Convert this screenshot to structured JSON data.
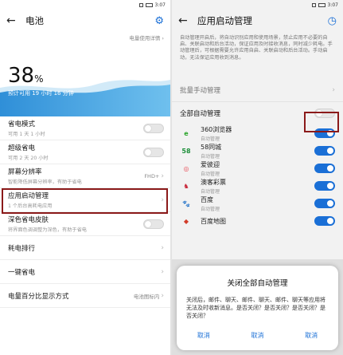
{
  "status": {
    "time": "3:07"
  },
  "left": {
    "title": "电池",
    "usage_link": "电量使用详情",
    "percent": "38",
    "percent_unit": "%",
    "estimate": "预计可用 19 小时 16 分钟",
    "items": [
      {
        "label": "省电模式",
        "sub": "可用 1 天 1 小时",
        "control": "switch-off"
      },
      {
        "label": "超级省电",
        "sub": "可用 2 天 20 小时",
        "control": "switch-off"
      },
      {
        "label": "屏幕分辨率",
        "sub": "智能降低屏幕分辨率，有助于省电",
        "value": "FHD+",
        "control": "chevron"
      },
      {
        "label": "应用启动管理",
        "sub": "1 个后台高耗电应用",
        "control": "chevron"
      },
      {
        "label": "深色省电皮肤",
        "sub": "将界面色调调整为深色，有助于省电",
        "control": "switch-off"
      },
      {
        "label": "耗电排行",
        "sub": "",
        "control": "chevron"
      },
      {
        "label": "一键省电",
        "sub": "",
        "control": "chevron"
      },
      {
        "label": "电量百分比显示方式",
        "sub": "",
        "value": "电池图标内",
        "control": "chevron"
      }
    ]
  },
  "right": {
    "title": "应用启动管理",
    "description": "自动管理开启后，将自动识别应用和使用场景，禁止应用不必要的自启、关联启动和后台活动，保证应用及时接收消息，同时减少耗电。手动管理后，可根据需要允许应用自启、关联启动和后台活动。手动启动，无法保证应用收到消息。",
    "batch_label": "批量手动管理",
    "all_label": "全部自动管理",
    "apps": [
      {
        "name": "360浏览器",
        "sub": "自动管理",
        "icon": "e",
        "color": "#2aa52a"
      },
      {
        "name": "58同城",
        "sub": "自动管理",
        "icon": "58",
        "color": "#1d8f3a"
      },
      {
        "name": "爱彼迎",
        "sub": "自动管理",
        "icon": "◎",
        "color": "#e8505b"
      },
      {
        "name": "澳客彩票",
        "sub": "自动管理",
        "icon": "♞",
        "color": "#c8283a"
      },
      {
        "name": "百度",
        "sub": "自动管理",
        "icon": "🐾",
        "color": "#2932e1"
      },
      {
        "name": "百度地图",
        "sub": "",
        "icon": "◆",
        "color": "#d23c2a"
      }
    ],
    "dialog": {
      "title": "关闭全部自动管理",
      "message": "关闭后，邮件、聊天、邮件、聊天、邮件、聊天等应用将无法及时收新消息。是否关闭？是否关闭？是否关闭？是否关闭？",
      "buttons": [
        "取消",
        "取消",
        "取消"
      ]
    }
  },
  "colors": {
    "accent": "#1a6fd6",
    "highlight": "#8b1a1a",
    "wave": "#3f9bde"
  }
}
